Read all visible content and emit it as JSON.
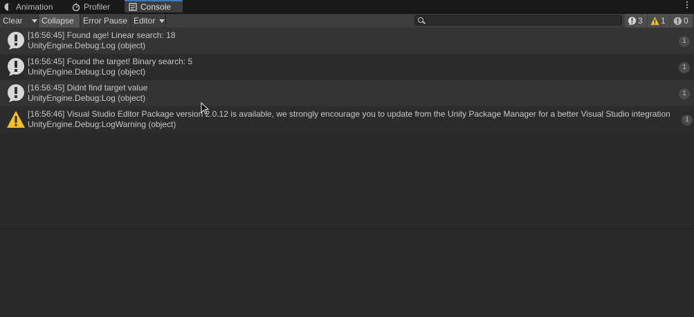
{
  "tabs": [
    {
      "label": "Animation",
      "icon": "animation-icon"
    },
    {
      "label": "Profiler",
      "icon": "profiler-icon"
    },
    {
      "label": "Console",
      "icon": "console-icon"
    }
  ],
  "toolbar": {
    "clear_label": "Clear",
    "collapse_label": "Collapse",
    "error_pause_label": "Error Pause",
    "editor_label": "Editor",
    "search_placeholder": ""
  },
  "counters": {
    "log_count": "3",
    "warning_count": "1",
    "error_count": "0"
  },
  "logs": [
    {
      "type": "log",
      "line1": "[16:56:45] Found age! Linear search: 18",
      "line2": "UnityEngine.Debug:Log (object)",
      "count": "1"
    },
    {
      "type": "log",
      "line1": "[16:56:45] Found the target! Binary search: 5",
      "line2": "UnityEngine.Debug:Log (object)",
      "count": "1"
    },
    {
      "type": "log",
      "line1": "[16:56:45] Didnt find target value",
      "line2": "UnityEngine.Debug:Log (object)",
      "count": "1"
    },
    {
      "type": "warning",
      "line1": "[16:56:46] Visual Studio Editor Package version 2.0.12 is available, we strongly encourage you to update from the Unity Package Manager for a better Visual Studio integration",
      "line2": "UnityEngine.Debug:LogWarning (object)",
      "count": "1"
    }
  ],
  "colors": {
    "background": "#282828",
    "toolbar": "#3c3c3c",
    "tab_accent": "#3a79bb",
    "warning_icon": "#f5c024",
    "log_icon": "#d8d8d8"
  }
}
